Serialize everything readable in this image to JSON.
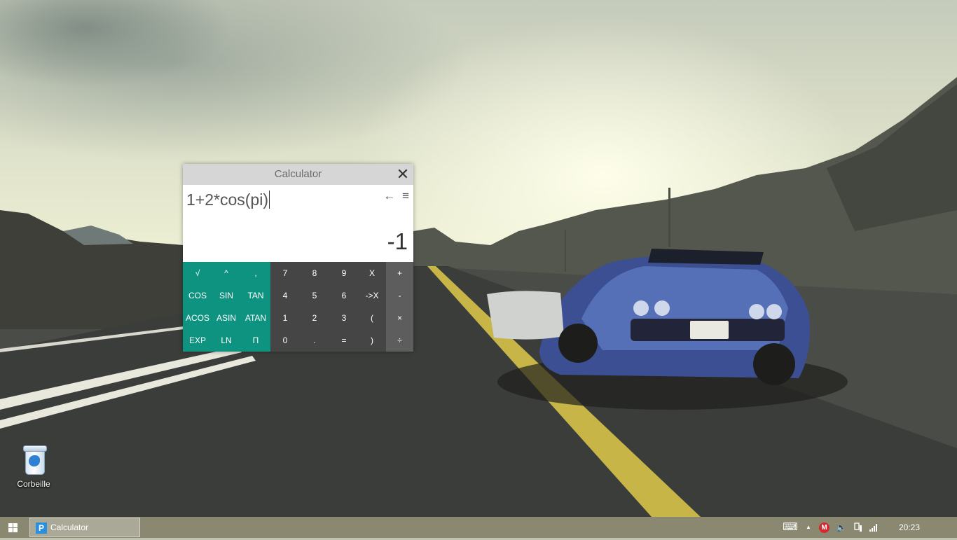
{
  "desktop": {
    "icons": [
      {
        "label": "Corbeille",
        "icon": "recycle-bin-icon"
      }
    ]
  },
  "calculator": {
    "title": "Calculator",
    "close_glyph": "✕",
    "backspace_glyph": "←",
    "menu_glyph": "≡",
    "expression": "1+2*cos(pi)",
    "result": "-1",
    "colors": {
      "scientific": "#0f9381",
      "numeric": "#454545",
      "operators": "#5d5d5d"
    },
    "keys": {
      "scientific": [
        [
          "√",
          "^",
          ","
        ],
        [
          "COS",
          "SIN",
          "TAN"
        ],
        [
          "ACOS",
          "ASIN",
          "ATAN"
        ],
        [
          "EXP",
          "LN",
          "Π"
        ]
      ],
      "numeric": [
        [
          "7",
          "8",
          "9",
          "X"
        ],
        [
          "4",
          "5",
          "6",
          "->X"
        ],
        [
          "1",
          "2",
          "3",
          "("
        ],
        [
          "0",
          ".",
          "=",
          ")"
        ]
      ],
      "operators": [
        "+",
        "-",
        "×",
        "÷"
      ]
    }
  },
  "taskbar": {
    "app_label": "Calculator",
    "app_icon_letter": "P",
    "tray": {
      "keyboard_icon": "⌨",
      "chevron_icon": "▲",
      "mega_letter": "M",
      "volume_icon": "🔈",
      "clock": "20:23"
    }
  }
}
